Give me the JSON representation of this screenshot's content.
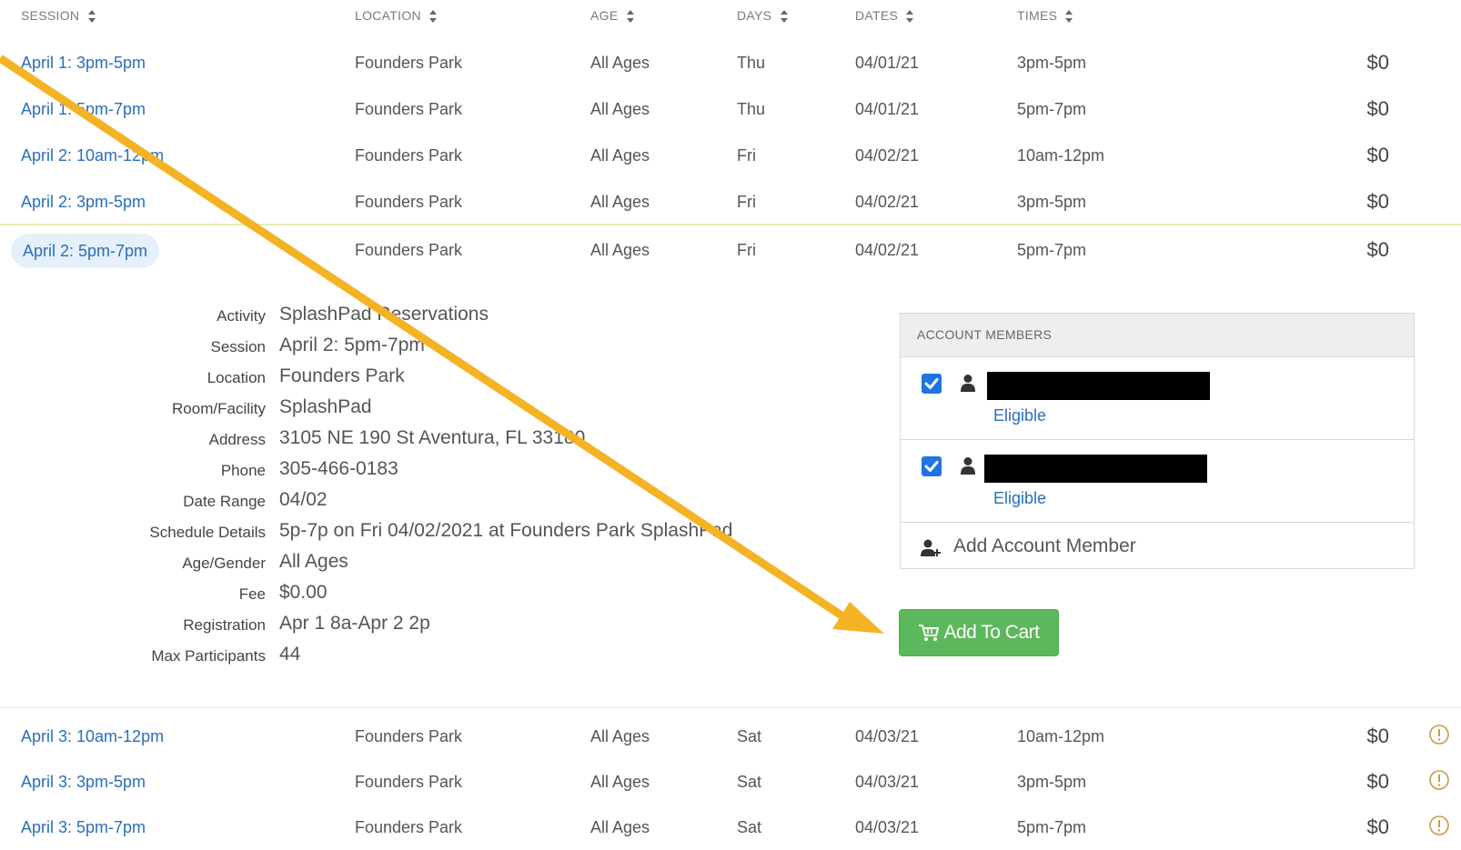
{
  "headers": {
    "session": "SESSION",
    "location": "LOCATION",
    "age": "AGE",
    "days": "DAYS",
    "dates": "DATES",
    "times": "TIMES"
  },
  "rows_top": [
    {
      "session": "April 1: 3pm-5pm",
      "location": "Founders Park",
      "age": "All Ages",
      "day": "Thu",
      "date": "04/01/21",
      "time": "3pm-5pm",
      "price": "$0"
    },
    {
      "session": "April 1: 5pm-7pm",
      "location": "Founders Park",
      "age": "All Ages",
      "day": "Thu",
      "date": "04/01/21",
      "time": "5pm-7pm",
      "price": "$0"
    },
    {
      "session": "April 2: 10am-12pm",
      "location": "Founders Park",
      "age": "All Ages",
      "day": "Fri",
      "date": "04/02/21",
      "time": "10am-12pm",
      "price": "$0"
    },
    {
      "session": "April 2: 3pm-5pm",
      "location": "Founders Park",
      "age": "All Ages",
      "day": "Fri",
      "date": "04/02/21",
      "time": "3pm-5pm",
      "price": "$0"
    }
  ],
  "selected_row": {
    "session": "April 2: 5pm-7pm",
    "location": "Founders Park",
    "age": "All Ages",
    "day": "Fri",
    "date": "04/02/21",
    "time": "5pm-7pm",
    "price": "$0"
  },
  "details": [
    {
      "label": "Activity",
      "value": "SplashPad Reservations"
    },
    {
      "label": "Session",
      "value": "April 2: 5pm-7pm"
    },
    {
      "label": "Location",
      "value": "Founders Park"
    },
    {
      "label": "Room/Facility",
      "value": "SplashPad"
    },
    {
      "label": "Address",
      "value": "3105 NE 190 St Aventura, FL 33180"
    },
    {
      "label": "Phone",
      "value": "305-466-0183"
    },
    {
      "label": "Date Range",
      "value": "04/02"
    },
    {
      "label": "Schedule Details",
      "value": "5p-7p on Fri 04/02/2021 at Founders Park SplashPad"
    },
    {
      "label": "Age/Gender",
      "value": "All Ages"
    },
    {
      "label": "Fee",
      "value": "$0.00"
    },
    {
      "label": "Registration",
      "value": "Apr 1 8a-Apr 2 2p"
    },
    {
      "label": "Max Participants",
      "value": "44"
    }
  ],
  "account_members": {
    "header": "ACCOUNT MEMBERS",
    "members": [
      {
        "status": "Eligible",
        "checked": true
      },
      {
        "status": "Eligible",
        "checked": true
      }
    ],
    "add_label": "Add Account Member"
  },
  "cart_button": {
    "label": "Add To Cart"
  },
  "rows_bottom": [
    {
      "session": "April 3: 10am-12pm",
      "location": "Founders Park",
      "age": "All Ages",
      "day": "Sat",
      "date": "04/03/21",
      "time": "10am-12pm",
      "price": "$0"
    },
    {
      "session": "April 3: 3pm-5pm",
      "location": "Founders Park",
      "age": "All Ages",
      "day": "Sat",
      "date": "04/03/21",
      "time": "3pm-5pm",
      "price": "$0"
    },
    {
      "session": "April 3: 5pm-7pm",
      "location": "Founders Park",
      "age": "All Ages",
      "day": "Sat",
      "date": "04/03/21",
      "time": "5pm-7pm",
      "price": "$0"
    }
  ],
  "colors": {
    "link": "#2a6ebb",
    "cart_button": "#5cb85c",
    "annotation_arrow": "#f4b324",
    "warning": "#c89b4a",
    "checkbox": "#1f75e0"
  },
  "icons": {
    "sort": "sort-icon",
    "person": "person-icon",
    "add_person": "add-person-icon",
    "cart": "cart-icon",
    "warning": "warning-icon"
  }
}
